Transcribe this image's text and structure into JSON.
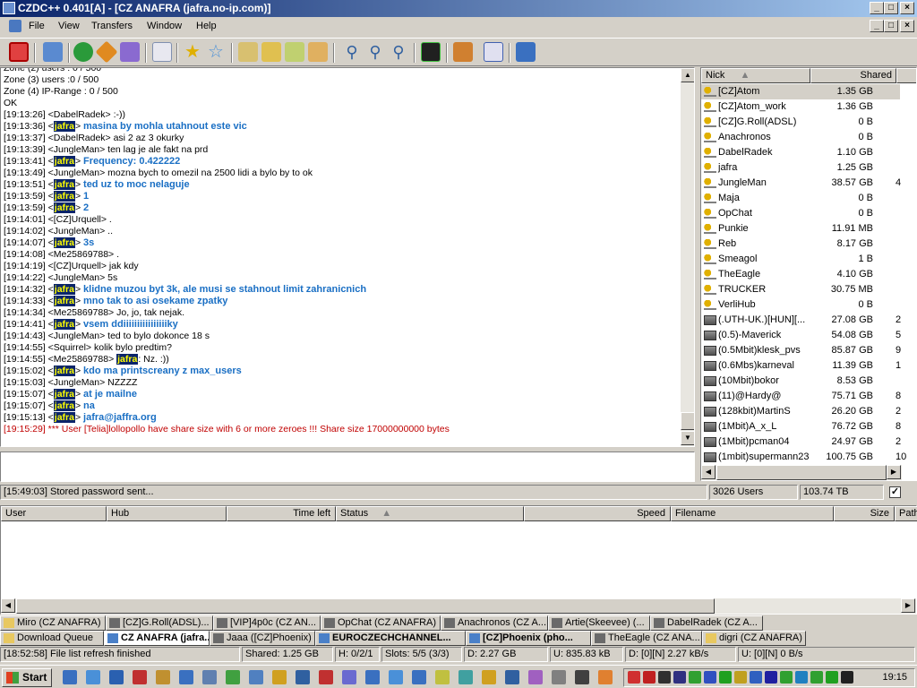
{
  "window": {
    "title": "CZDC++ 0.401[A] - [CZ ANAFRA (jafra.no-ip.com)]"
  },
  "menu": [
    "File",
    "View",
    "Transfers",
    "Window",
    "Help"
  ],
  "chat": {
    "lines": [
      {
        "text": "Zone (2) users : 0 / 500",
        "style": "normal"
      },
      {
        "text": "Zone (3) users :0 / 500",
        "style": "normal"
      },
      {
        "text": " Zone (4) IP-Range : 0 / 500",
        "style": "normal"
      },
      {
        "text": "OK",
        "style": "normal"
      },
      {
        "text": "[19:13:26] <DabelRadek> :-))",
        "style": "normal"
      },
      {
        "time": "[19:13:36]",
        "nick": "jafra",
        "msg": "masina by mohla utahnout este vic",
        "style": "self"
      },
      {
        "text": "[19:13:37] <DabelRadek> asi 2 az 3 okurky",
        "style": "normal"
      },
      {
        "text": "[19:13:39] <JungleMan> ten lag je ale fakt na prd",
        "style": "normal"
      },
      {
        "time": "[19:13:41]",
        "nick": "jafra",
        "msg": "Frequency: 0.422222",
        "style": "self"
      },
      {
        "text": "[19:13:49] <JungleMan> mozna bych to omezil na 2500 lidi a bylo by to ok",
        "style": "normal"
      },
      {
        "time": "[19:13:51]",
        "nick": "jafra",
        "msg": "ted uz to moc nelaguje",
        "style": "self"
      },
      {
        "time": "[19:13:59]",
        "nick": "jafra",
        "msg": "1",
        "style": "self"
      },
      {
        "time": "[19:13:59]",
        "nick": "jafra",
        "msg": "2",
        "style": "self"
      },
      {
        "text": "[19:14:01] <[CZ]Urquell> .",
        "style": "normal"
      },
      {
        "text": "[19:14:02] <JungleMan> ..",
        "style": "normal"
      },
      {
        "time": "[19:14:07]",
        "nick": "jafra",
        "msg": "3s",
        "style": "self"
      },
      {
        "text": "[19:14:08] <Me25869788> .",
        "style": "normal"
      },
      {
        "text": "[19:14:19] <[CZ]Urquell> jak kdy",
        "style": "normal"
      },
      {
        "text": "[19:14:22] <JungleMan> 5s",
        "style": "normal"
      },
      {
        "time": "[19:14:32]",
        "nick": "jafra",
        "msg": "klidne muzou byt 3k, ale musi se stahnout limit zahranicnich",
        "style": "self"
      },
      {
        "time": "[19:14:33]",
        "nick": "jafra",
        "msg": "mno tak to asi osekame zpatky",
        "style": "self"
      },
      {
        "text": "[19:14:34] <Me25869788> Jo, jo, tak nejak.",
        "style": "normal"
      },
      {
        "time": "[19:14:41]",
        "nick": "jafra",
        "msg": "vsem ddiiiiiiiiiiiiiiiiky",
        "style": "self"
      },
      {
        "text": "[19:14:43] <JungleMan> ted to bylo dokonce 18 s",
        "style": "normal"
      },
      {
        "text": "[19:14:55] <Squirrel> kolik bylo predtim?",
        "style": "normal"
      },
      {
        "time": "[19:14:55]",
        "pre": "<Me25869788>",
        "nick": "jafra",
        "msg": ": Nz. :))",
        "style": "mention"
      },
      {
        "time": "[19:15:02]",
        "nick": "jafra",
        "msg": "kdo ma printscreany z max_users",
        "style": "self"
      },
      {
        "text": "[19:15:03] <JungleMan> NZZZZ",
        "style": "normal"
      },
      {
        "time": "[19:15:07]",
        "nick": "jafra",
        "msg": "at je mailne",
        "style": "self"
      },
      {
        "time": "[19:15:07]",
        "nick": "jafra",
        "msg": "na",
        "style": "self"
      },
      {
        "time": "[19:15:13]",
        "nick": "jafra",
        "msg": "jafra@jaffra.org",
        "style": "self"
      },
      {
        "text": "[19:15:29] *** User [Telia]lollopollo have share size with 6 or more zeroes !!! Share size 17000000000 bytes",
        "style": "sys"
      }
    ]
  },
  "userlist": {
    "columns": {
      "nick": "Nick",
      "shared": "Shared"
    },
    "users": [
      {
        "nick": "[CZ]Atom",
        "shared": "1.35 GB",
        "icon": "key-user-icon",
        "extra": ""
      },
      {
        "nick": "[CZ]Atom_work",
        "shared": "1.36 GB",
        "icon": "key-user-icon",
        "extra": ""
      },
      {
        "nick": "[CZ]G.Roll(ADSL)",
        "shared": "0 B",
        "icon": "key-user-icon",
        "extra": ""
      },
      {
        "nick": "Anachronos",
        "shared": "0 B",
        "icon": "key-user-icon",
        "extra": ""
      },
      {
        "nick": "DabelRadek",
        "shared": "1.10 GB",
        "icon": "key-user-icon",
        "extra": ""
      },
      {
        "nick": "jafra",
        "shared": "1.25 GB",
        "icon": "key-user-icon",
        "extra": ""
      },
      {
        "nick": "JungleMan",
        "shared": "38.57 GB",
        "icon": "key-user-icon",
        "extra": "4"
      },
      {
        "nick": "Maja",
        "shared": "0 B",
        "icon": "key-user-icon",
        "extra": ""
      },
      {
        "nick": "OpChat",
        "shared": "0 B",
        "icon": "key-user-icon",
        "extra": ""
      },
      {
        "nick": "Punkie",
        "shared": "11.91 MB",
        "icon": "key-user-icon",
        "extra": ""
      },
      {
        "nick": "Reb",
        "shared": "8.17 GB",
        "icon": "key-user-icon",
        "extra": ""
      },
      {
        "nick": "Smeagol",
        "shared": "1 B",
        "icon": "key-user-icon",
        "extra": ""
      },
      {
        "nick": "TheEagle",
        "shared": "4.10 GB",
        "icon": "key-user-icon",
        "extra": ""
      },
      {
        "nick": "TRUCKER",
        "shared": "30.75 MB",
        "icon": "key-user-icon",
        "extra": ""
      },
      {
        "nick": "VerliHub",
        "shared": "0 B",
        "icon": "key-user-icon",
        "extra": ""
      },
      {
        "nick": "(.UTH-UK.)[HUN][...",
        "shared": "27.08 GB",
        "icon": "modem-user-icon",
        "extra": "2"
      },
      {
        "nick": "(0.5)-Maverick",
        "shared": "54.08 GB",
        "icon": "modem-user-icon",
        "extra": "5"
      },
      {
        "nick": "(0.5Mbit)klesk_pvs",
        "shared": "85.87 GB",
        "icon": "modem-user-icon",
        "extra": "9"
      },
      {
        "nick": "(0.6Mbs)karneval",
        "shared": "11.39 GB",
        "icon": "modem-user-icon",
        "extra": "1"
      },
      {
        "nick": "(10Mbit)bokor",
        "shared": "8.53 GB",
        "icon": "modem-user-icon",
        "extra": ""
      },
      {
        "nick": "(11)@Hardy@",
        "shared": "75.71 GB",
        "icon": "modem-user-icon",
        "extra": "8"
      },
      {
        "nick": "(128kbit)MartinS",
        "shared": "26.20 GB",
        "icon": "modem-user-icon",
        "extra": "2"
      },
      {
        "nick": "(1Mbit)A_x_L",
        "shared": "76.72 GB",
        "icon": "modem-user-icon",
        "extra": "8"
      },
      {
        "nick": "(1Mbit)pcman04",
        "shared": "24.97 GB",
        "icon": "modem-user-icon",
        "extra": "2"
      },
      {
        "nick": "(1mbit)supermann23",
        "shared": "100.75 GB",
        "icon": "modem-user-icon",
        "extra": "10"
      }
    ]
  },
  "hub_status": {
    "message": "[15:49:03] Stored password sent...",
    "users": "3026 Users",
    "total_shared": "103.74 TB",
    "checkbox": "✓"
  },
  "transfers": {
    "columns": [
      "User",
      "Hub",
      "Time left",
      "Status",
      "Speed",
      "Filename",
      "Size",
      "Path"
    ]
  },
  "tabs_row1": [
    {
      "label": "Miro (CZ ANAFRA)",
      "icon": "folder-icon"
    },
    {
      "label": "[CZ]G.Roll(ADSL)...",
      "icon": "user-icon"
    },
    {
      "label": "[VIP]4p0c (CZ AN...",
      "icon": "user-icon"
    },
    {
      "label": "OpChat (CZ ANAFRA)",
      "icon": "user-icon"
    },
    {
      "label": "Anachronos (CZ A...",
      "icon": "user-icon"
    },
    {
      "label": "Artie(Skeevee) (...",
      "icon": "user-icon"
    },
    {
      "label": "DabelRadek (CZ A...",
      "icon": "user-icon"
    }
  ],
  "tabs_row2": [
    {
      "label": "Download Queue",
      "icon": "folder-icon"
    },
    {
      "label": "CZ ANAFRA (jafra...",
      "icon": "hub-icon",
      "active": true
    },
    {
      "label": "Jaaa ([CZ]Phoenix)",
      "icon": "user-icon"
    },
    {
      "label": "EUROCZECHCHANNEL...",
      "icon": "hub-icon",
      "bold": true
    },
    {
      "label": "[CZ]Phoenix (pho...",
      "icon": "hub-icon",
      "bold": true
    },
    {
      "label": "TheEagle (CZ ANA...",
      "icon": "user-icon"
    },
    {
      "label": "digri (CZ ANAFRA)",
      "icon": "folder-icon"
    }
  ],
  "statusbar": {
    "message": "[18:52:58] File list refresh finished",
    "shared": "Shared: 1.25 GB",
    "hubs": "H: 0/2/1",
    "slots": "Slots: 5/5 (3/3)",
    "downloaded": "D: 2.27 GB",
    "uploaded": "U: 835.83 kB",
    "down_rate": "D: [0][N] 2.27 kB/s",
    "up_rate": "U: [0][N] 0 B/s"
  },
  "taskbar": {
    "start": "Start",
    "clock": "19:15"
  },
  "colors": {
    "title_gradient_start": "#0a246a",
    "title_gradient_end": "#a6caf0",
    "self_message": "#1a6fc4",
    "system_message": "#c00000",
    "nick_highlight_bg": "#0a246a",
    "nick_highlight_fg": "#ffff00"
  }
}
